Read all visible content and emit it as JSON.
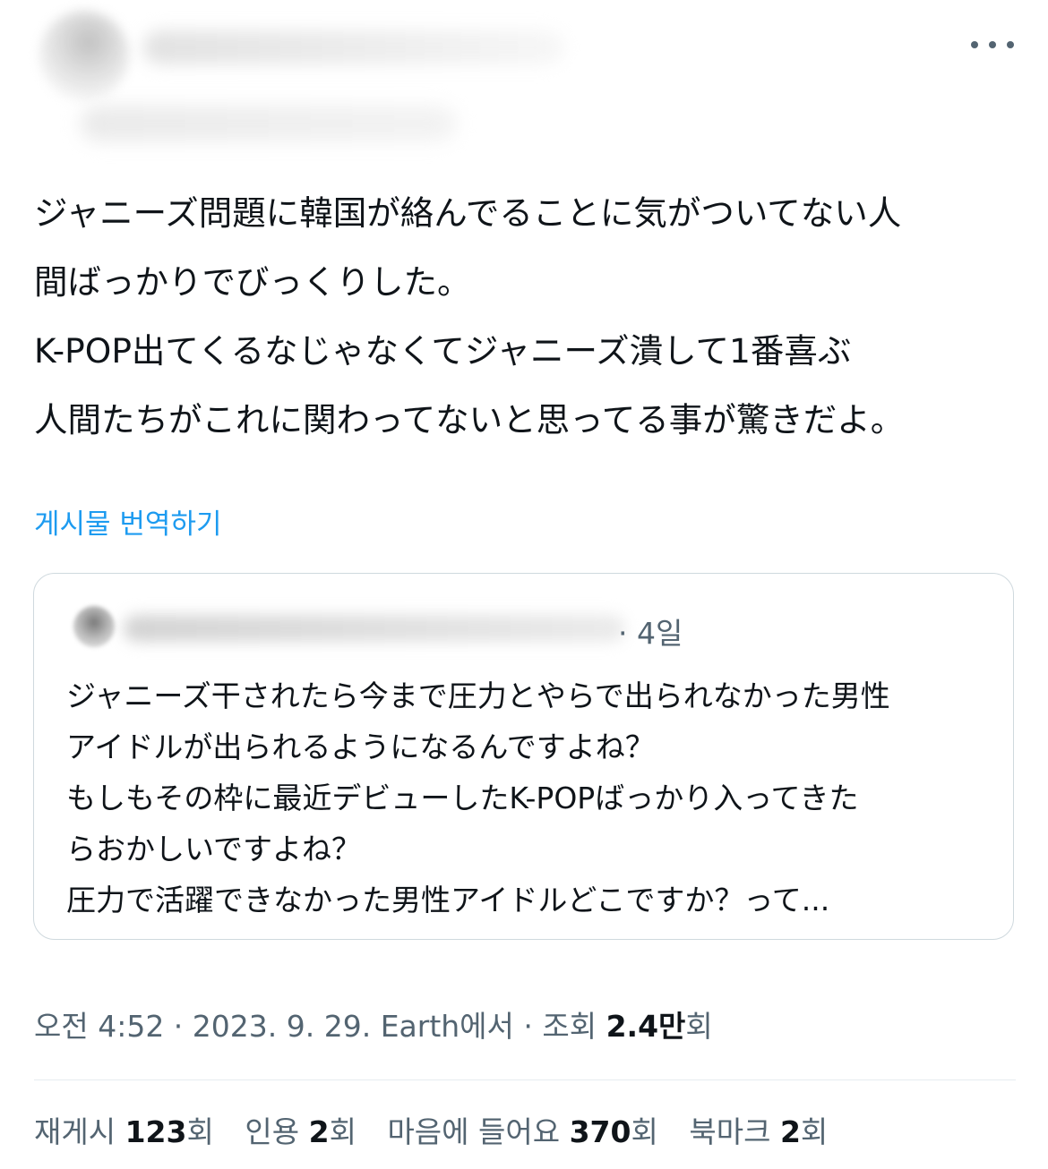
{
  "author": {
    "avatar_icon": "avatar-icon",
    "more_icon": "more-icon"
  },
  "tweet": {
    "lines": [
      "ジャニーズ問題に韓国が絡んでることに気がついてない人",
      "間ばっかりでびっくりした。",
      "K-POP出てくるなじゃなくてジャニーズ潰して1番喜ぶ",
      "人間たちがこれに関わってないと思ってる事が驚きだよ。"
    ],
    "translate_label": "게시물 번역하기"
  },
  "quoted": {
    "time_text": "· 4일",
    "lines": [
      "ジャニーズ干されたら今まで圧力とやらで出られなかった男性",
      "アイドルが出られるようになるんですよね？",
      "もしもその枠に最近デビューしたK-POPばっかり入ってきた",
      "らおかしいですよね？",
      "圧力で活躍できなかった男性アイドルどこですか？って..."
    ]
  },
  "meta": {
    "prefix": "오전 4:52 · 2023. 9. 29. Earth에서 · 조회 ",
    "views": "2.4만",
    "suffix": "회"
  },
  "stats": {
    "reposts_label": "재게시",
    "reposts_value": "123",
    "quotes_label": "인용",
    "quotes_value": "2",
    "likes_label": "마음에 들어요",
    "likes_value": "370",
    "bookmarks_label": "북마크",
    "bookmarks_value": "2",
    "unit": "회"
  },
  "colors": {
    "link": "#1d9bf0",
    "secondary": "#536471",
    "text": "#0f1419",
    "border": "#cfd9de"
  }
}
